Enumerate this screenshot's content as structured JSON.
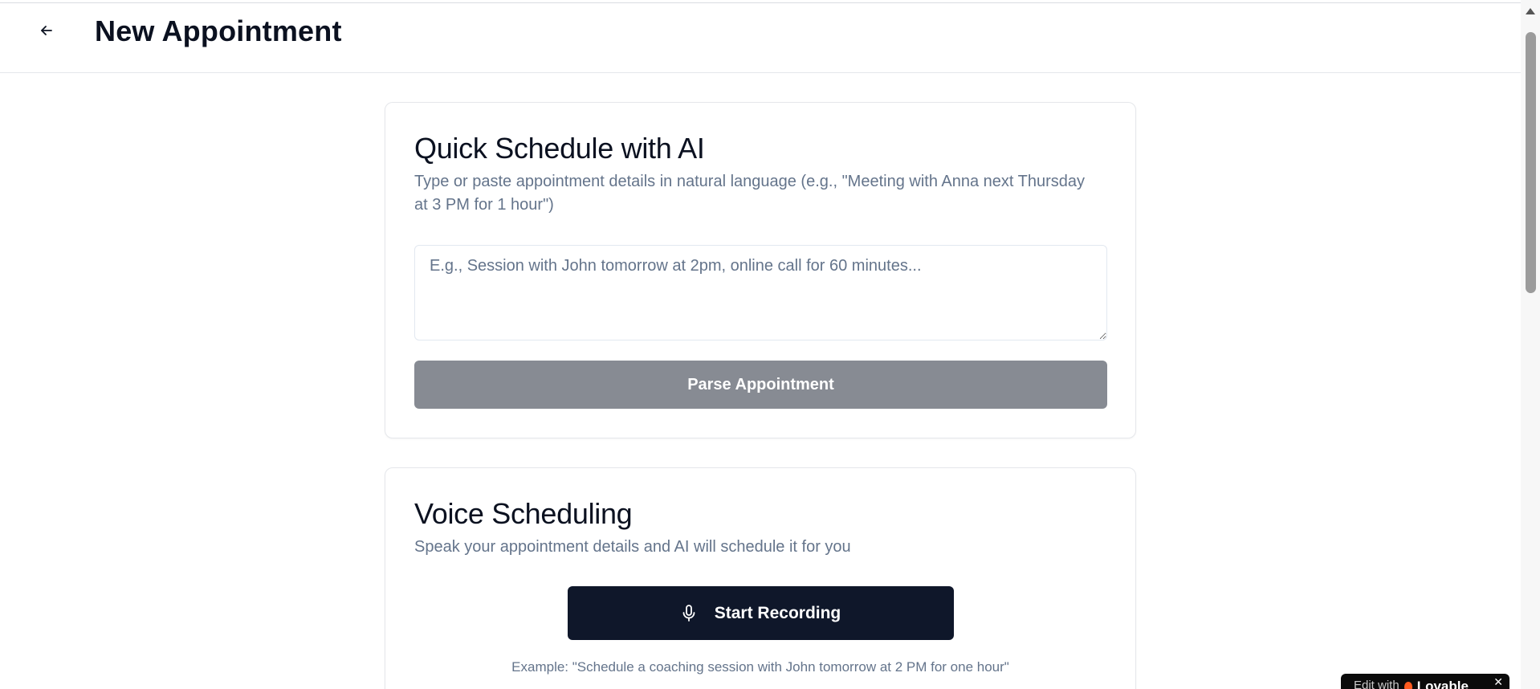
{
  "header": {
    "back_icon": "arrow-left-icon",
    "title": "New Appointment"
  },
  "quick_schedule": {
    "title": "Quick Schedule with AI",
    "description": "Type or paste appointment details in natural language (e.g., \"Meeting with Anna next Thursday at 3 PM for 1 hour\")",
    "input_value": "",
    "input_placeholder": "E.g., Session with John tomorrow at 2pm, online call for 60 minutes...",
    "parse_button_label": "Parse Appointment"
  },
  "voice_scheduling": {
    "title": "Voice Scheduling",
    "description": "Speak your appointment details and AI will schedule it for you",
    "record_button_label": "Start Recording",
    "record_icon": "microphone-icon",
    "example": "Example: \"Schedule a coaching session with John tomorrow at 2 PM for one hour\""
  },
  "badge": {
    "edit_text": "Edit with",
    "brand": "Lovable",
    "close_label": "✕"
  },
  "colors": {
    "primary_dark": "#0f172a",
    "button_disabled": "#878b93",
    "muted_text": "#64748b",
    "border": "#e5e7eb"
  }
}
